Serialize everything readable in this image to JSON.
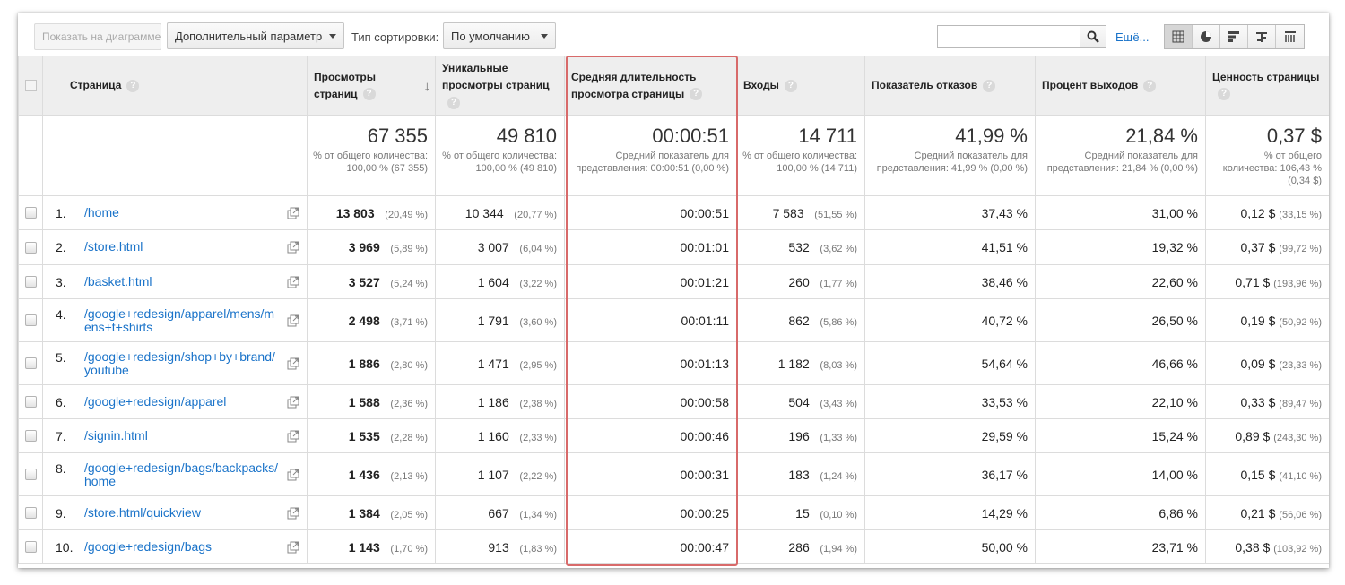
{
  "toolbar": {
    "show_chart_label": "Показать на диаграмме",
    "extra_param_label": "Дополнительный параметр",
    "sort_type_label": "Тип сортировки:",
    "sort_select_value": "По умолчанию",
    "search_value": "",
    "more_label": "Ещё..."
  },
  "columns": {
    "page": "Страница",
    "pageviews": "Просмотры страниц",
    "unique_pageviews": "Уникальные просмотры страниц",
    "avg_time": "Средняя длительность просмотра страницы",
    "entrances": "Входы",
    "bounce_rate": "Показатель отказов",
    "exit_pct": "Процент выходов",
    "page_value": "Ценность страницы"
  },
  "totals": {
    "pageviews": {
      "value": "67 355",
      "sub": "% от общего количества: 100,00 % (67 355)"
    },
    "unique_pageviews": {
      "value": "49 810",
      "sub": "% от общего количества: 100,00 % (49 810)"
    },
    "avg_time": {
      "value": "00:00:51",
      "sub": "Средний показатель для представления: 00:00:51 (0,00 %)"
    },
    "entrances": {
      "value": "14 711",
      "sub": "% от общего количества: 100,00 % (14 711)"
    },
    "bounce_rate": {
      "value": "41,99 %",
      "sub": "Средний показатель для представления: 41,99 % (0,00 %)"
    },
    "exit_pct": {
      "value": "21,84 %",
      "sub": "Средний показатель для представления: 21,84 % (0,00 %)"
    },
    "page_value": {
      "value": "0,37 $",
      "sub": "% от общего количества: 106,43 % (0,34 $)"
    }
  },
  "rows": [
    {
      "idx": "1.",
      "page": "/home",
      "pv": "13 803",
      "pv_pct": "(20,49 %)",
      "upv": "10 344",
      "upv_pct": "(20,77 %)",
      "avg": "00:00:51",
      "ent": "7 583",
      "ent_pct": "(51,55 %)",
      "bounce": "37,43 %",
      "exit": "31,00 %",
      "val": "0,12 $",
      "val_pct": "(33,15 %)"
    },
    {
      "idx": "2.",
      "page": "/store.html",
      "pv": "3 969",
      "pv_pct": "(5,89 %)",
      "upv": "3 007",
      "upv_pct": "(6,04 %)",
      "avg": "00:01:01",
      "ent": "532",
      "ent_pct": "(3,62 %)",
      "bounce": "41,51 %",
      "exit": "19,32 %",
      "val": "0,37 $",
      "val_pct": "(99,72 %)"
    },
    {
      "idx": "3.",
      "page": "/basket.html",
      "pv": "3 527",
      "pv_pct": "(5,24 %)",
      "upv": "1 604",
      "upv_pct": "(3,22 %)",
      "avg": "00:01:21",
      "ent": "260",
      "ent_pct": "(1,77 %)",
      "bounce": "38,46 %",
      "exit": "22,60 %",
      "val": "0,71 $",
      "val_pct": "(193,96 %)"
    },
    {
      "idx": "4.",
      "page": "/google+redesign/apparel/mens/mens+t+shirts",
      "pv": "2 498",
      "pv_pct": "(3,71 %)",
      "upv": "1 791",
      "upv_pct": "(3,60 %)",
      "avg": "00:01:11",
      "ent": "862",
      "ent_pct": "(5,86 %)",
      "bounce": "40,72 %",
      "exit": "26,50 %",
      "val": "0,19 $",
      "val_pct": "(50,92 %)"
    },
    {
      "idx": "5.",
      "page": "/google+redesign/shop+by+brand/youtube",
      "pv": "1 886",
      "pv_pct": "(2,80 %)",
      "upv": "1 471",
      "upv_pct": "(2,95 %)",
      "avg": "00:01:13",
      "ent": "1 182",
      "ent_pct": "(8,03 %)",
      "bounce": "54,64 %",
      "exit": "46,66 %",
      "val": "0,09 $",
      "val_pct": "(23,33 %)"
    },
    {
      "idx": "6.",
      "page": "/google+redesign/apparel",
      "pv": "1 588",
      "pv_pct": "(2,36 %)",
      "upv": "1 186",
      "upv_pct": "(2,38 %)",
      "avg": "00:00:58",
      "ent": "504",
      "ent_pct": "(3,43 %)",
      "bounce": "33,53 %",
      "exit": "22,10 %",
      "val": "0,33 $",
      "val_pct": "(89,47 %)"
    },
    {
      "idx": "7.",
      "page": "/signin.html",
      "pv": "1 535",
      "pv_pct": "(2,28 %)",
      "upv": "1 160",
      "upv_pct": "(2,33 %)",
      "avg": "00:00:46",
      "ent": "196",
      "ent_pct": "(1,33 %)",
      "bounce": "29,59 %",
      "exit": "15,24 %",
      "val": "0,89 $",
      "val_pct": "(243,30 %)"
    },
    {
      "idx": "8.",
      "page": "/google+redesign/bags/backpacks/home",
      "pv": "1 436",
      "pv_pct": "(2,13 %)",
      "upv": "1 107",
      "upv_pct": "(2,22 %)",
      "avg": "00:00:31",
      "ent": "183",
      "ent_pct": "(1,24 %)",
      "bounce": "36,17 %",
      "exit": "14,00 %",
      "val": "0,15 $",
      "val_pct": "(41,10 %)"
    },
    {
      "idx": "9.",
      "page": "/store.html/quickview",
      "pv": "1 384",
      "pv_pct": "(2,05 %)",
      "upv": "667",
      "upv_pct": "(1,34 %)",
      "avg": "00:00:25",
      "ent": "15",
      "ent_pct": "(0,10 %)",
      "bounce": "14,29 %",
      "exit": "6,86 %",
      "val": "0,21 $",
      "val_pct": "(56,06 %)"
    },
    {
      "idx": "10.",
      "page": "/google+redesign/bags",
      "pv": "1 143",
      "pv_pct": "(1,70 %)",
      "upv": "913",
      "upv_pct": "(1,83 %)",
      "avg": "00:00:47",
      "ent": "286",
      "ent_pct": "(1,94 %)",
      "bounce": "50,00 %",
      "exit": "23,71 %",
      "val": "0,38 $",
      "val_pct": "(103,92 %)"
    }
  ],
  "colors": {
    "link": "#1a73c9",
    "highlight": "#d86a6a",
    "header_bg": "#eeeeee"
  }
}
